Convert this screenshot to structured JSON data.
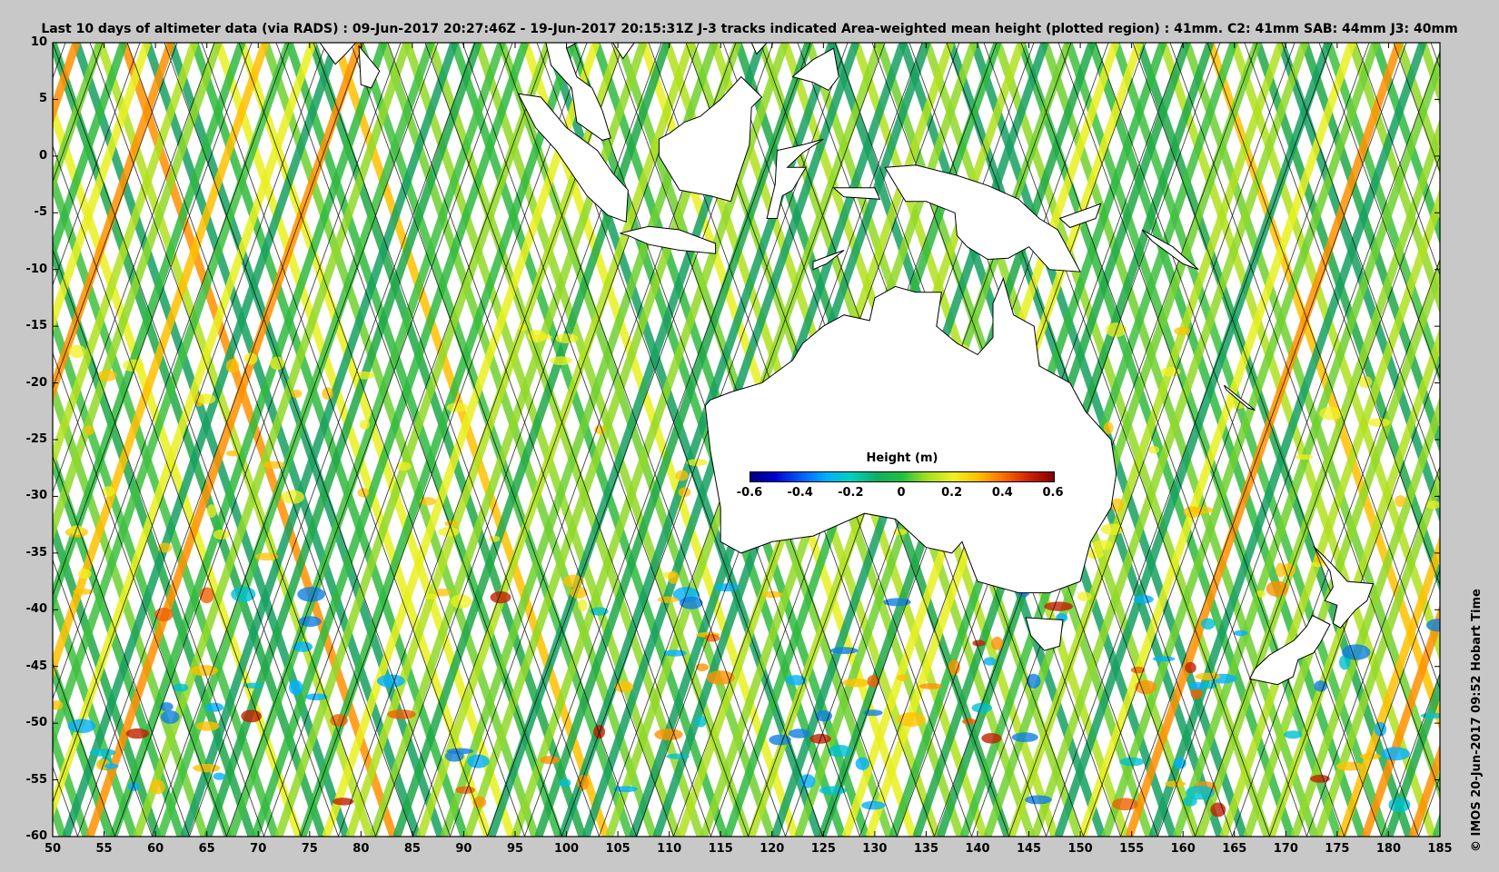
{
  "title": "Last 10 days of altimeter data (via RADS) : 09-Jun-2017 20:27:46Z - 19-Jun-2017 20:15:31Z  J-3 tracks indicated  Area-weighted mean height (plotted region) : 41mm.  C2: 41mm  SAB: 44mm  J3: 40mm",
  "credit": "© IMOS 20-Jun-2017 09:52 Hobart Time",
  "colorbar": {
    "title": "Height (m)",
    "ticks": [
      "-0.6",
      "-0.4",
      "-0.2",
      "0",
      "0.2",
      "0.4",
      "0.6"
    ],
    "colors": [
      "#000080",
      "#0060ff",
      "#00c8e0",
      "#20b050",
      "#f0f020",
      "#ff9000",
      "#800000"
    ]
  },
  "map": {
    "lon_range": [
      50,
      185
    ],
    "lat_range": [
      -60,
      10
    ],
    "x_ticks": [
      "50",
      "55",
      "60",
      "65",
      "70",
      "75",
      "80",
      "85",
      "90",
      "95",
      "100",
      "105",
      "110",
      "115",
      "120",
      "125",
      "130",
      "135",
      "140",
      "145",
      "150",
      "155",
      "160",
      "165",
      "170",
      "175",
      "180",
      "185"
    ],
    "y_ticks": [
      "10",
      "5",
      "0",
      "-5",
      "-10",
      "-15",
      "-20",
      "-25",
      "-30",
      "-35",
      "-40",
      "-45",
      "-50",
      "-55",
      "-60"
    ],
    "land_color": "#ffffff",
    "track_color": "#000000"
  }
}
